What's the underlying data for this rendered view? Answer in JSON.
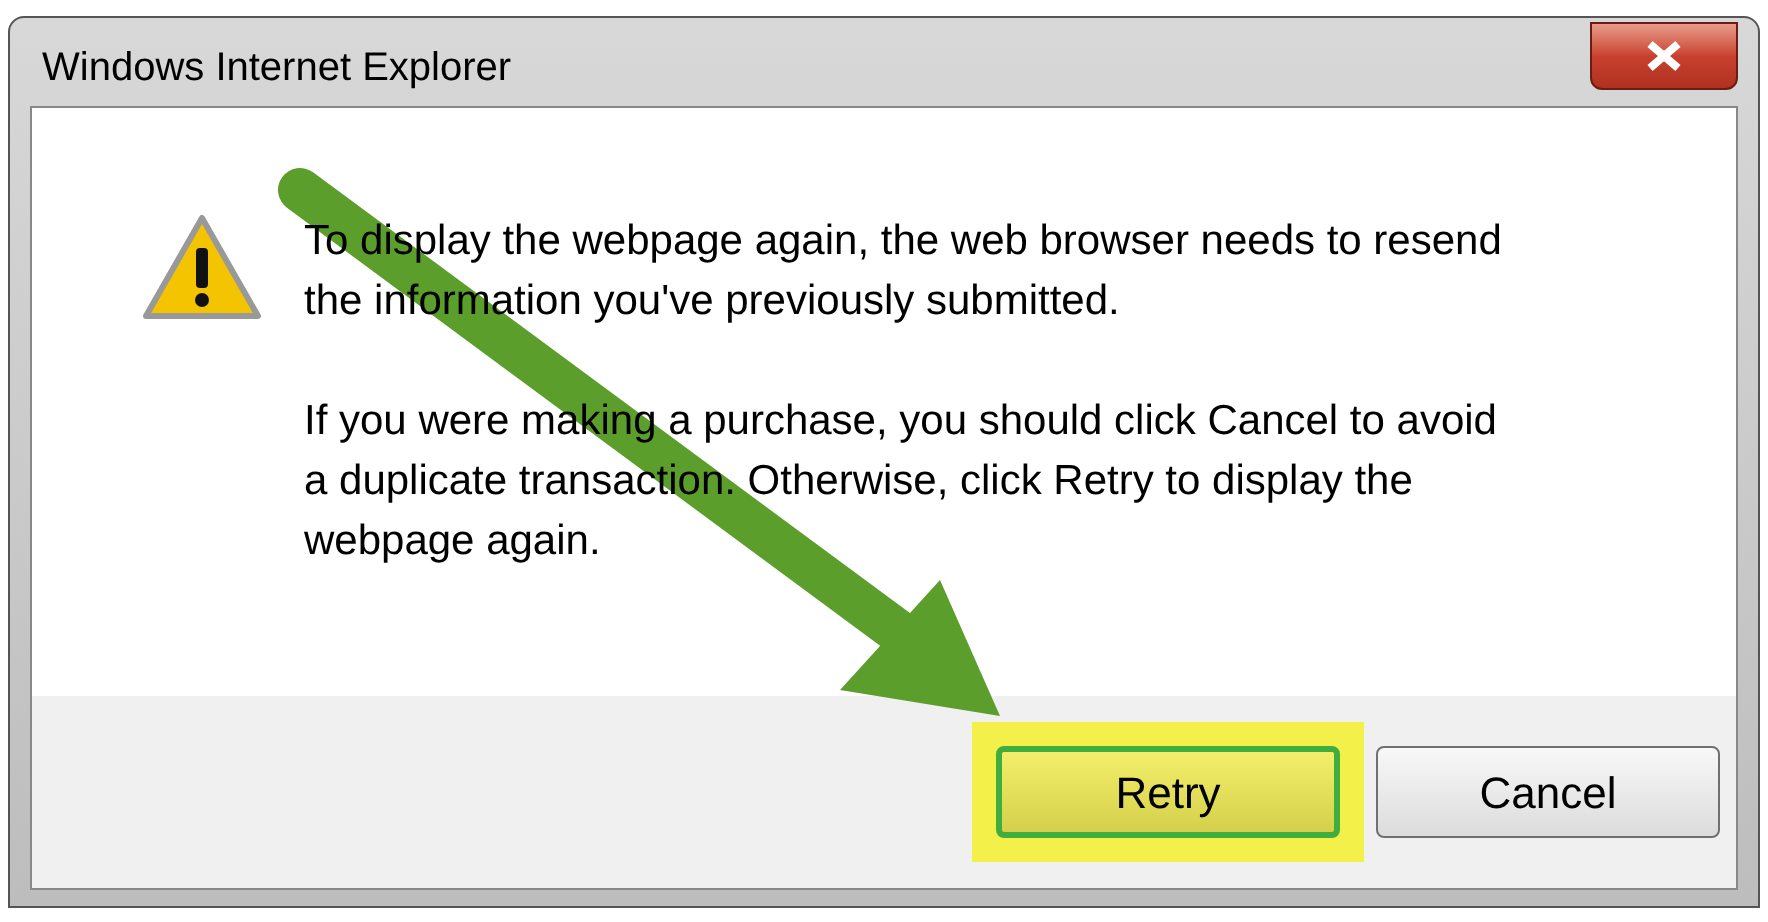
{
  "window": {
    "title": "Windows Internet Explorer"
  },
  "message": {
    "paragraphs": [
      "To display the webpage again, the web browser needs to resend the information you've previously submitted.",
      "If you were making a purchase, you should click Cancel to avoid a duplicate transaction. Otherwise, click Retry to display the webpage again."
    ]
  },
  "buttons": [
    {
      "label": "Retry",
      "default": true,
      "highlighted": true
    },
    {
      "label": "Cancel",
      "default": false,
      "highlighted": false
    }
  ],
  "annotation": {
    "kind": "arrow"
  }
}
